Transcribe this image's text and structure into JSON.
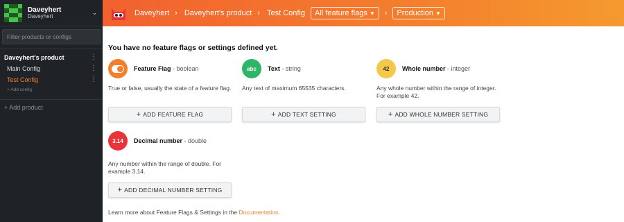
{
  "sidebar": {
    "org_name": "Daveyhert",
    "org_sub": "Daveyhert",
    "filter_placeholder": "Filter products or configs",
    "product_name": "Daveyhert's product",
    "configs": [
      {
        "label": "Main Config",
        "active": false
      },
      {
        "label": "Test Config",
        "active": true
      }
    ],
    "add_config": "+ Add config",
    "add_product": "+ Add product"
  },
  "topbar": {
    "crumb_org": "Daveyhert",
    "crumb_product": "Daveyhert's product",
    "crumb_config": "Test Config",
    "feature_dropdown": "All feature flags",
    "env_dropdown": "Production"
  },
  "main": {
    "heading": "You have no feature flags or settings defined yet.",
    "cards": [
      {
        "icon_text": "",
        "icon_name": "toggle-icon",
        "color": "#f47e2b",
        "title": "Feature Flag",
        "type": " - boolean",
        "desc": "True or false, usually the state of a feature flag.",
        "button": "ADD FEATURE FLAG"
      },
      {
        "icon_text": "abc",
        "icon_name": "text-icon",
        "color": "#2eb567",
        "title": "Text",
        "type": " - string",
        "desc": "Any text of maximum 65535 characters.",
        "button": "ADD TEXT SETTING"
      },
      {
        "icon_text": "42",
        "icon_name": "number-icon",
        "color": "#f4c94a",
        "title": "Whole number",
        "type": " - integer",
        "desc": "Any whole number within the range of integer. For example 42.",
        "button": "ADD WHOLE NUMBER SETTING"
      },
      {
        "icon_text": "3.14",
        "icon_name": "decimal-icon",
        "color": "#e8333a",
        "title": "Decimal number",
        "type": " - double",
        "desc": "Any number within the range of double. For example 3.14.",
        "button": "ADD DECIMAL NUMBER SETTING"
      }
    ],
    "footer_text": "Learn more about Feature Flags & Settings in the ",
    "footer_link": "Documentation."
  }
}
